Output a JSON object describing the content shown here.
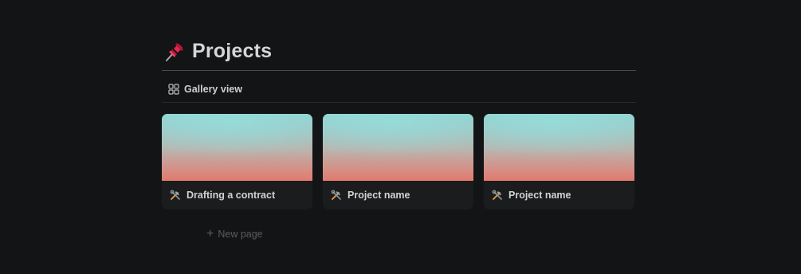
{
  "page": {
    "title": "Projects",
    "icon": "pushpin-icon"
  },
  "view": {
    "label": "Gallery view",
    "icon": "gallery-grid-icon"
  },
  "cards": [
    {
      "title": "Drafting a contract",
      "icon": "hammer-and-wrench-icon"
    },
    {
      "title": "Project name",
      "icon": "hammer-and-wrench-icon"
    },
    {
      "title": "Project name",
      "icon": "hammer-and-wrench-icon"
    }
  ],
  "new_page": {
    "label": "New page",
    "icon": "plus-icon"
  },
  "colors": {
    "background": "#131416",
    "card": "#1b1c1e",
    "cover_top": "#8fd2d0",
    "cover_bottom": "#e47a6e",
    "muted_text": "#5c5d60"
  }
}
